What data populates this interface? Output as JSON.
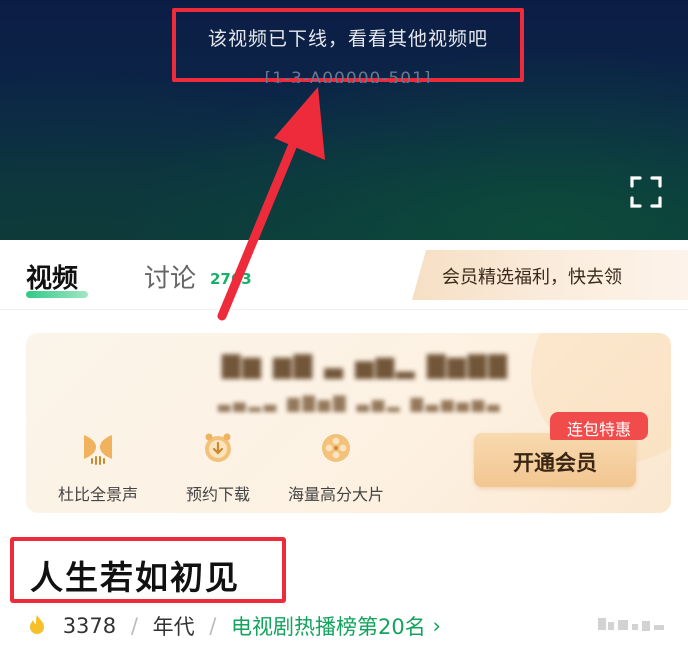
{
  "player": {
    "message": "该视频已下线，看看其他视频吧",
    "error_code": "[1-3-A00000-501]",
    "fullscreen_icon": "fullscreen-icon"
  },
  "tabs": {
    "video_label": "视频",
    "discuss_label": "讨论",
    "discuss_count": "2763",
    "promo_text": "会员精选福利，快去领"
  },
  "vip_card": {
    "features": [
      {
        "label": "杜比全景声",
        "icon": "dolby-audio-icon"
      },
      {
        "label": "预约下载",
        "icon": "download-clock-icon"
      },
      {
        "label": "海量高分大片",
        "icon": "film-reel-icon"
      }
    ],
    "open_button": "开通会员",
    "deal_badge": "连包特惠"
  },
  "show": {
    "title": "人生若如初见",
    "heat": "3378",
    "separator": "/",
    "era": "年代",
    "rank": "电视剧热播榜第20名",
    "rank_chevron": "›"
  },
  "colors": {
    "annotation_red": "#ee2b3b",
    "accent_green": "#18b06a",
    "vip_gold": "#f2c690",
    "badge_red": "#f24b4b"
  }
}
